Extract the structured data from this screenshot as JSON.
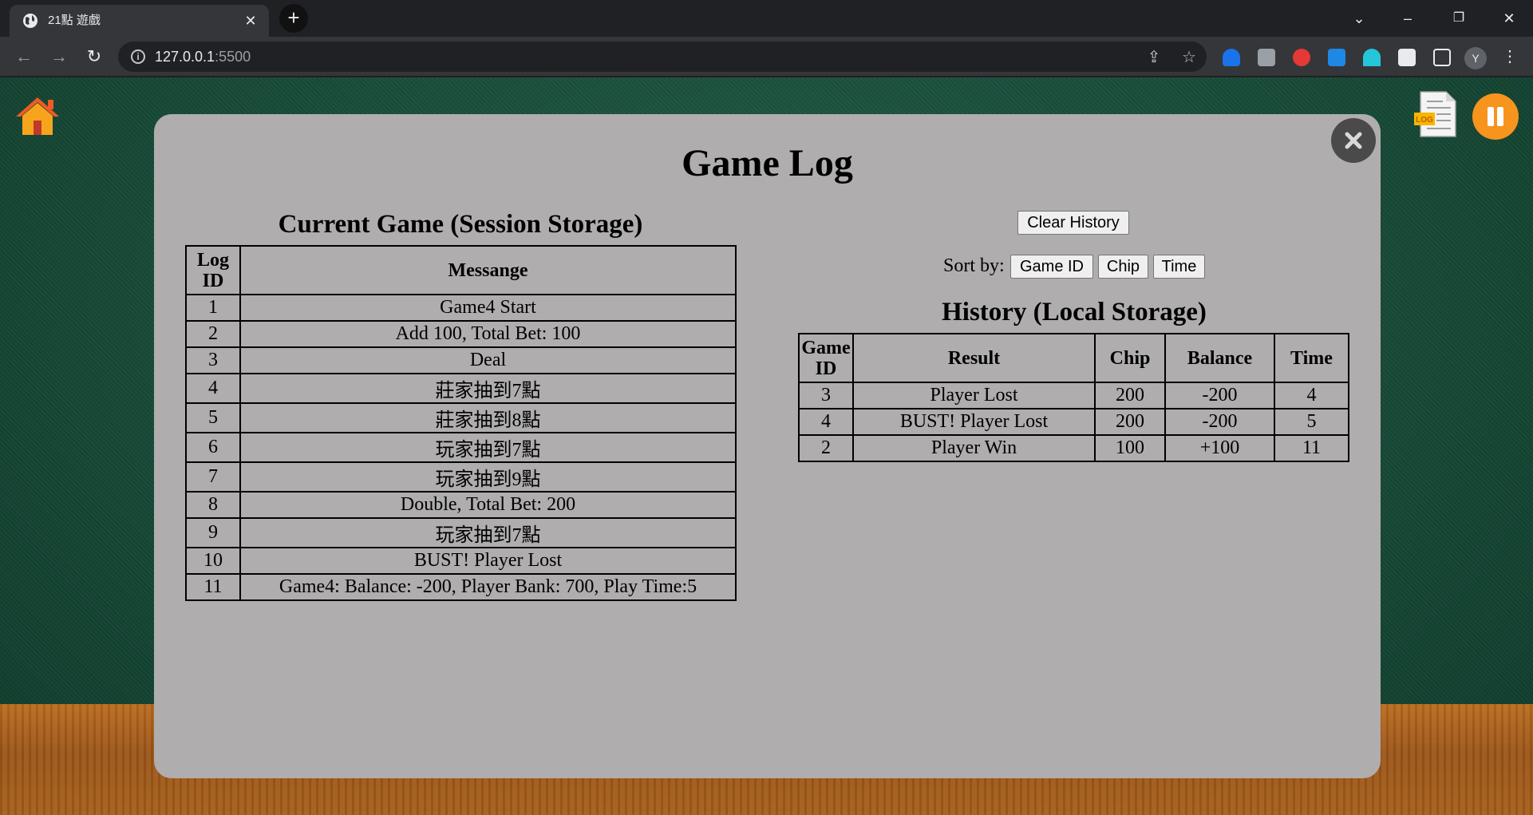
{
  "browser": {
    "tab_title": "21點 遊戲",
    "url_host": "127.0.0.1",
    "url_port": ":5500",
    "profile_initial": "Y"
  },
  "modal": {
    "title": "Game Log",
    "current_game": {
      "title": "Current Game (Session Storage)",
      "headers": [
        "Log ID",
        "Messange"
      ],
      "rows": [
        {
          "id": "1",
          "message": "Game4 Start"
        },
        {
          "id": "2",
          "message": "Add 100, Total Bet: 100"
        },
        {
          "id": "3",
          "message": "Deal"
        },
        {
          "id": "4",
          "message": "莊家抽到7點"
        },
        {
          "id": "5",
          "message": "莊家抽到8點"
        },
        {
          "id": "6",
          "message": "玩家抽到7點"
        },
        {
          "id": "7",
          "message": "玩家抽到9點"
        },
        {
          "id": "8",
          "message": "Double, Total Bet: 200"
        },
        {
          "id": "9",
          "message": "玩家抽到7點"
        },
        {
          "id": "10",
          "message": "BUST! Player Lost"
        },
        {
          "id": "11",
          "message": "Game4: Balance: -200, Player Bank: 700, Play Time:5"
        }
      ]
    },
    "history": {
      "clear_label": "Clear History",
      "sort_label": "Sort by:",
      "sort_buttons": [
        "Game ID",
        "Chip",
        "Time"
      ],
      "title": "History (Local Storage)",
      "headers": [
        "Game ID",
        "Result",
        "Chip",
        "Balance",
        "Time"
      ],
      "rows": [
        {
          "game_id": "3",
          "result": "Player Lost",
          "chip": "200",
          "balance": "-200",
          "time": "4"
        },
        {
          "game_id": "4",
          "result": "BUST! Player Lost",
          "chip": "200",
          "balance": "-200",
          "time": "5"
        },
        {
          "game_id": "2",
          "result": "Player Win",
          "chip": "100",
          "balance": "+100",
          "time": "11"
        }
      ]
    }
  },
  "icons": {
    "home": "home-icon",
    "log": "log-icon",
    "pause": "pause-icon",
    "close": "close-icon",
    "log_badge": "LOG"
  },
  "colors": {
    "felt": "#174a37",
    "wood": "#a55d18",
    "modal_bg": "#afadad",
    "pause": "#f7941d",
    "close_bg": "#4a4a4a",
    "home_roof": "#f15a24",
    "home_body": "#f7a41d"
  }
}
